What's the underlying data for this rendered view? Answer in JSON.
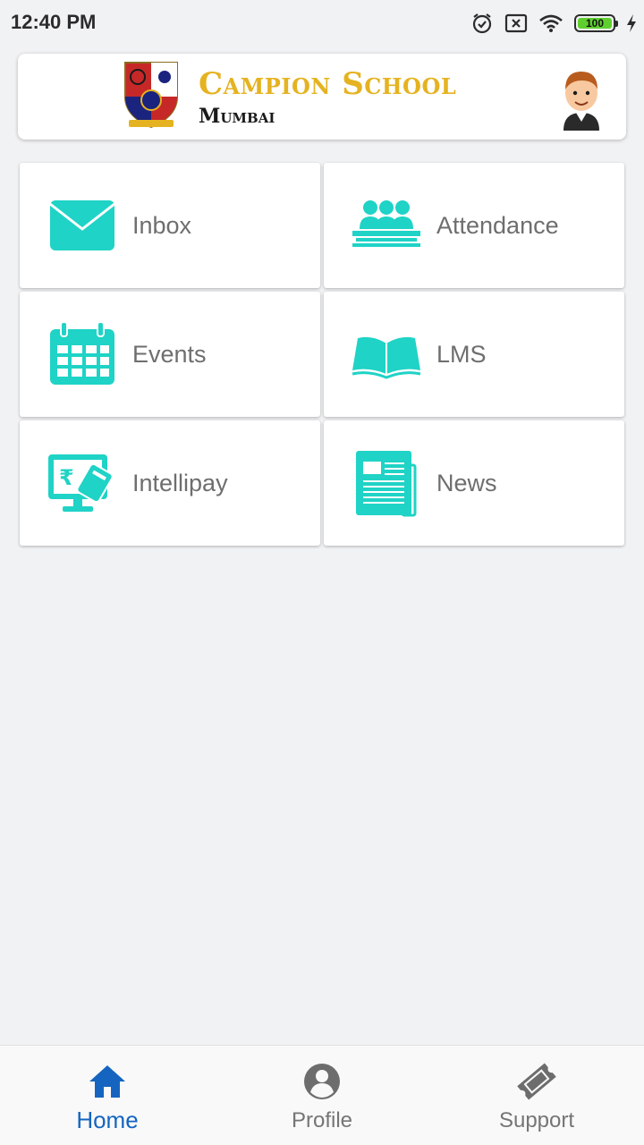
{
  "status_bar": {
    "time": "12:40 PM",
    "battery": "100",
    "icons": [
      "alarm-icon",
      "sim-off-icon",
      "wifi-icon",
      "battery-icon",
      "charging-icon"
    ]
  },
  "header": {
    "school_name": "Campion School",
    "city": "Mumbai",
    "crest_icon": "school-crest-icon",
    "avatar_icon": "boy-avatar-icon"
  },
  "tiles": [
    {
      "label": "Inbox",
      "icon": "envelope-icon"
    },
    {
      "label": "Attendance",
      "icon": "classroom-icon"
    },
    {
      "label": "Events",
      "icon": "calendar-icon"
    },
    {
      "label": "LMS",
      "icon": "open-book-icon"
    },
    {
      "label": "Intellipay",
      "icon": "payment-monitor-icon"
    },
    {
      "label": "News",
      "icon": "newspaper-icon"
    }
  ],
  "bottom_nav": [
    {
      "label": "Home",
      "icon": "home-icon",
      "active": true
    },
    {
      "label": "Profile",
      "icon": "profile-icon",
      "active": false
    },
    {
      "label": "Support",
      "icon": "ticket-icon",
      "active": false
    }
  ],
  "colors": {
    "accent": "#1fd3c6",
    "active_nav": "#1565c0",
    "title_gold": "#e5b321",
    "background": "#f1f2f4"
  }
}
